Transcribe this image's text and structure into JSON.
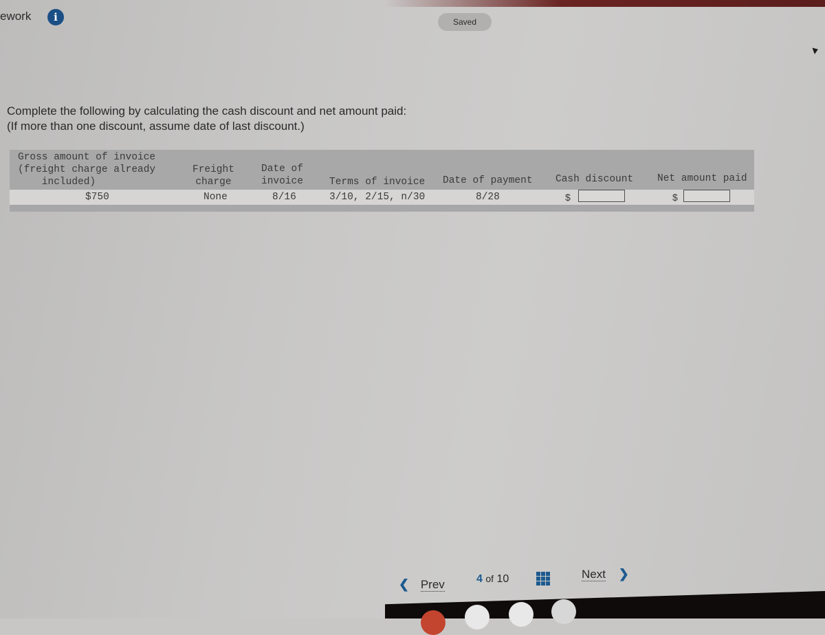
{
  "header": {
    "title": "ework",
    "info_icon": "info-icon",
    "saved_status": "Saved"
  },
  "instructions": {
    "line1": "Complete the following by calculating the cash discount and net amount paid:",
    "line2": "(If more than one discount, assume date of last discount.)"
  },
  "table": {
    "headers": {
      "gross": "Gross amount of invoice\n(freight charge already\n    included)",
      "freight": "Freight\ncharge",
      "date_invoice": "Date of\ninvoice",
      "terms": "Terms of invoice",
      "date_payment": "Date of payment",
      "cash_discount": "Cash discount",
      "net_amount": "Net amount paid"
    },
    "row": {
      "gross": "$750",
      "freight": "None",
      "date_invoice": "8/16",
      "terms": "3/10, 2/15, n/30",
      "date_payment": "8/28",
      "cash_discount_prefix": "$",
      "cash_discount_value": "",
      "net_amount_prefix": "$",
      "net_amount_value": ""
    }
  },
  "navigation": {
    "prev_label": "Prev",
    "prev_icon": "chevron-left-icon",
    "current_page": "4",
    "of_label": "of",
    "total_pages": "10",
    "grid_icon": "grid-icon",
    "next_label": "Next",
    "next_icon": "chevron-right-icon"
  },
  "colors": {
    "accent": "#1d5a8f",
    "info_icon_bg": "#1a4f86",
    "table_header_bg": "#a9a8a8"
  }
}
